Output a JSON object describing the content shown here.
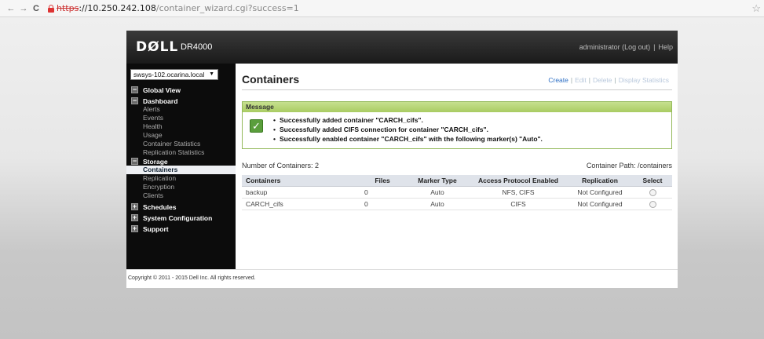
{
  "browser": {
    "url_scheme": "https",
    "url_host": "://10.250.242.108",
    "url_path": "/container_wizard.cgi?success=1",
    "back_icon": "←",
    "forward_icon": "→",
    "reload_icon": "C",
    "star_icon": "☆"
  },
  "header": {
    "logo": "DØLL",
    "product": "DR4000",
    "user_link": "administrator (Log out)",
    "separator": "|",
    "help_link": "Help"
  },
  "sidebar": {
    "host": "swsys-102.ocarina.local",
    "host_arrow": "▼",
    "sections": [
      {
        "label": "Global View",
        "icon": "−",
        "items": []
      },
      {
        "label": "Dashboard",
        "icon": "−",
        "items": [
          "Alerts",
          "Events",
          "Health",
          "Usage",
          "Container Statistics",
          "Replication Statistics"
        ]
      },
      {
        "label": "Storage",
        "icon": "−",
        "items": [
          "Containers",
          "Replication",
          "Encryption",
          "Clients"
        ]
      },
      {
        "label": "Schedules",
        "icon": "+",
        "items": []
      },
      {
        "label": "System Configuration",
        "icon": "+",
        "items": []
      },
      {
        "label": "Support",
        "icon": "+",
        "items": []
      }
    ]
  },
  "main": {
    "title": "Containers",
    "actions": {
      "create": "Create",
      "edit": "Edit",
      "delete": "Delete",
      "display_statistics": "Display Statistics",
      "sep": "|"
    },
    "message": {
      "heading": "Message",
      "check_icon": "✓",
      "lines": [
        "Successfully added container \"CARCH_cifs\".",
        "Successfully added CIFS connection for container \"CARCH_cifs\".",
        "Successfully enabled container \"CARCH_cifs\" with the following marker(s) \"Auto\"."
      ]
    },
    "count_text": "Number of Containers: 2",
    "path_text": "Container Path: /containers",
    "table": {
      "headers": [
        "Containers",
        "Files",
        "Marker Type",
        "Access Protocol Enabled",
        "Replication",
        "Select"
      ],
      "rows": [
        [
          "backup",
          "0",
          "Auto",
          "NFS, CIFS",
          "Not Configured"
        ],
        [
          "CARCH_cifs",
          "0",
          "Auto",
          "CIFS",
          "Not Configured"
        ]
      ]
    }
  },
  "footer": {
    "copyright": "Copyright © 2011 - 2015 Dell Inc. All rights reserved."
  },
  "colors": {
    "message_border": "#93b95a",
    "message_header": "#a9cc62",
    "link": "#2a6dc4",
    "sidebar_bg": "#0c0c0c",
    "active_nav_bg": "#eef0f4"
  }
}
